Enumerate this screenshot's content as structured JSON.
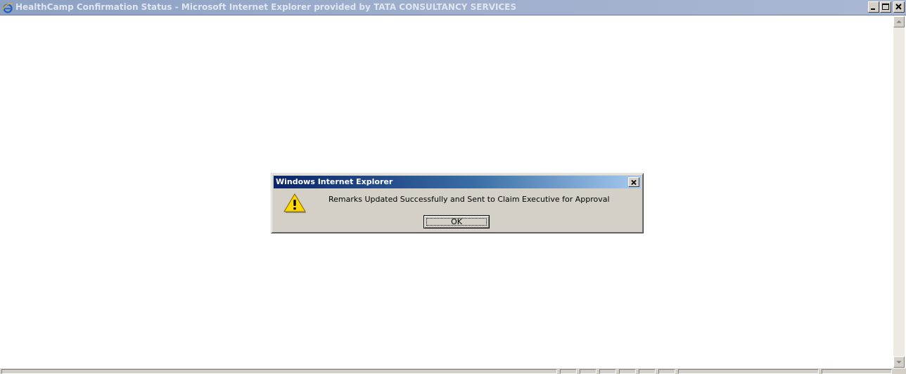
{
  "window": {
    "title": "HealthCamp Confirmation Status - Microsoft Internet Explorer provided by TATA CONSULTANCY SERVICES",
    "icon": "ie-icon",
    "controls": [
      "minimize-icon",
      "maximize-icon",
      "close-icon"
    ]
  },
  "dialog": {
    "title": "Windows Internet Explorer",
    "icon": "warning-icon",
    "message": "Remarks Updated Successfully and Sent to Claim Executive for Approval",
    "ok_label": "OK"
  },
  "colors": {
    "inactive_titlebar": "#9caccb",
    "dialog_titlebar": "#0a246a",
    "dialog_face": "#d4d0c8",
    "warning_yellow": "#ffd700"
  }
}
